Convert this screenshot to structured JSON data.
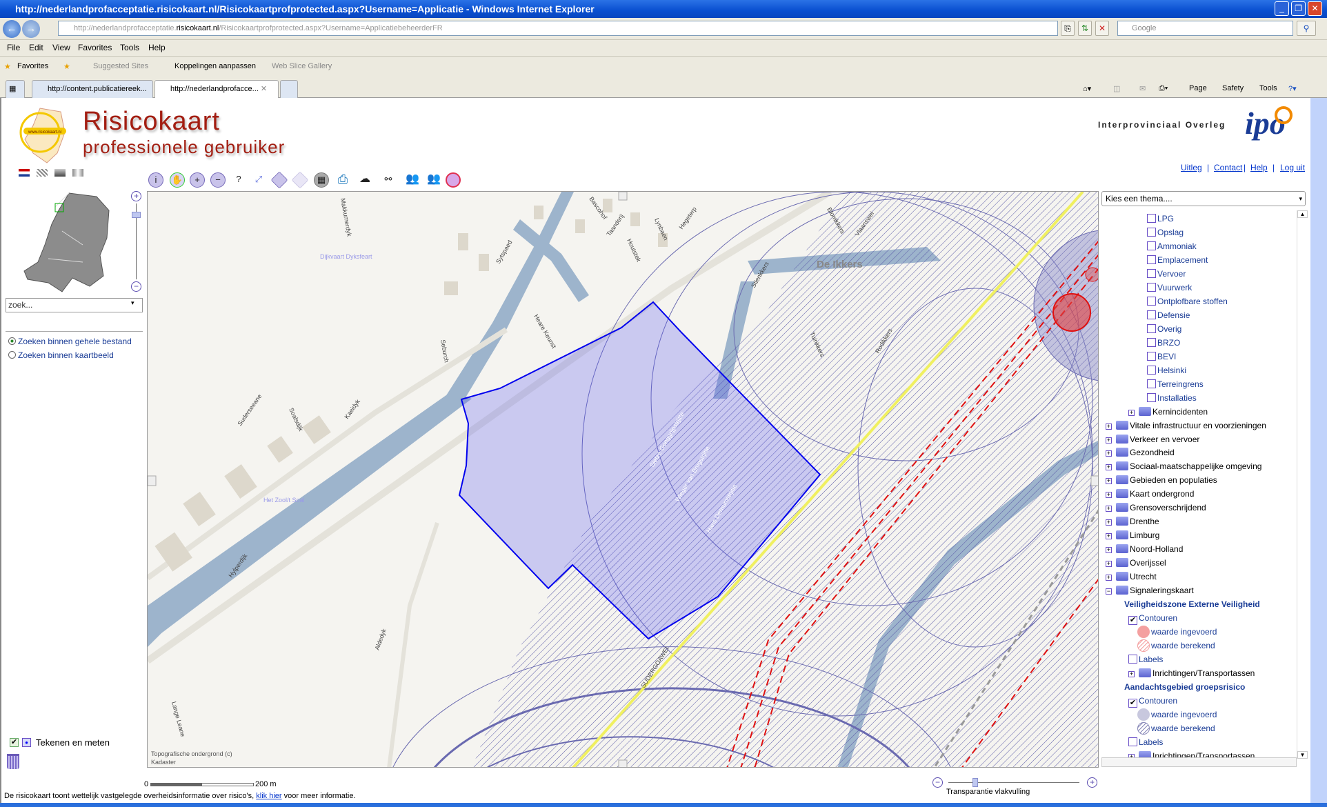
{
  "browser": {
    "title": "http://nederlandprofacceptatie.risicokaart.nl/Risicokaartprofprotected.aspx?Username=Applicatie - Windows Internet Explorer",
    "address_pre": "http://nederlandprofacceptatie.",
    "address_domain": "risicokaart.nl",
    "address_post": "/Risicokaartprofprotected.aspx?Username=ApplicatiebeheerderFR",
    "search_placeholder": "Google",
    "menu": [
      "File",
      "Edit",
      "View",
      "Favorites",
      "Tools",
      "Help"
    ],
    "favorites": {
      "label": "Favorites",
      "items": [
        "Suggested Sites",
        "Koppelingen aanpassen",
        "Web Slice Gallery"
      ]
    },
    "tabs": [
      {
        "label": "http://content.publicatiereek..."
      },
      {
        "label": "http://nederlandprofacce...",
        "active": true
      }
    ],
    "commands": [
      "Page",
      "Safety",
      "Tools"
    ]
  },
  "header": {
    "title": "Risicokaart",
    "subtitle": "professionele gebruiker",
    "logo_text": "www.risicokaart.nl",
    "partner": "Interprovinciaal Overleg",
    "partner_logo": "ipo",
    "links": [
      "Uitleg",
      "Contact",
      "Help",
      "Log uit"
    ]
  },
  "toolbar": {
    "icons": [
      "info-icon",
      "pan-hand-icon",
      "zoom-in-icon",
      "zoom-out-icon",
      "query-icon",
      "full-extent-icon",
      "back-icon",
      "forward-icon",
      "select-icon",
      "print-icon",
      "draw-shape-icon",
      "link-icon",
      "users-icon",
      "users-document-icon",
      "overlap-icon"
    ]
  },
  "left": {
    "search_placeholder": "zoek...",
    "radios": [
      {
        "label": "Zoeken binnen gehele bestand",
        "checked": true
      },
      {
        "label": "Zoeken binnen kaartbeeld",
        "checked": false
      }
    ],
    "draw_label": "Tekenen en meten",
    "scale": {
      "start": "0",
      "end": "200 m"
    },
    "footer_pre": "De risicokaart toont wettelijk vastgelegde overheidsinformatie over risico's, ",
    "footer_link": "klik hier",
    "footer_post": " voor meer informatie."
  },
  "map": {
    "labels": [
      "De Ikkers",
      "Dijkvaart Dyksfeart",
      "Het Zool/t Soal",
      "Makkumerdyk",
      "Sytspaed",
      "Bascohof",
      "Taanderij",
      "Houtstek",
      "Lynbaen",
      "Hegeterp",
      "Heare Keunst",
      "Seburch",
      "Suderseeane",
      "Soalsdijk",
      "Kaeidyk",
      "Hylperdijk",
      "Aldedyk",
      "Lange Leane",
      "Sietze Gonggrijpstrjitte",
      "Wieger van Brugstrjitte",
      "Hans Dernumstrjitte",
      "SUDERGOAWEI",
      "Stienkkers",
      "Blomkkers",
      "Rodikkers",
      "Tuinkkers",
      "Vlaanswei",
      "Topografische ondergrond (c)",
      "Kadaster"
    ],
    "transparency_label": "Transparantie vlakvulling",
    "transparency": 0.2
  },
  "panel": {
    "select": "Kies een thema....",
    "tree": [
      {
        "t": "cb",
        "l": 3,
        "label": "LPG"
      },
      {
        "t": "cb",
        "l": 3,
        "label": "Opslag"
      },
      {
        "t": "cb",
        "l": 3,
        "label": "Ammoniak"
      },
      {
        "t": "cb",
        "l": 3,
        "label": "Emplacement"
      },
      {
        "t": "cb",
        "l": 3,
        "label": "Vervoer"
      },
      {
        "t": "cb",
        "l": 3,
        "label": "Vuurwerk"
      },
      {
        "t": "cb",
        "l": 3,
        "label": "Ontplofbare stoffen"
      },
      {
        "t": "cb",
        "l": 3,
        "label": "Defensie"
      },
      {
        "t": "cb",
        "l": 3,
        "label": "Overig"
      },
      {
        "t": "cb",
        "l": 3,
        "label": "BRZO"
      },
      {
        "t": "cb",
        "l": 3,
        "label": "BEVI"
      },
      {
        "t": "cb",
        "l": 3,
        "label": "Helsinki"
      },
      {
        "t": "cb",
        "l": 3,
        "label": "Terreingrens"
      },
      {
        "t": "cb",
        "l": 3,
        "label": "Installaties"
      },
      {
        "t": "folder",
        "l": 1,
        "label": "Kernincidenten"
      },
      {
        "t": "folder",
        "l": 0,
        "label": "Vitale infrastructuur en voorzieningen"
      },
      {
        "t": "folder",
        "l": 0,
        "label": "Verkeer en vervoer"
      },
      {
        "t": "folder",
        "l": 0,
        "label": "Gezondheid"
      },
      {
        "t": "folder",
        "l": 0,
        "label": "Sociaal-maatschappelijke omgeving"
      },
      {
        "t": "folder",
        "l": 0,
        "label": "Gebieden en populaties"
      },
      {
        "t": "folder",
        "l": 0,
        "label": "Kaart ondergrond"
      },
      {
        "t": "folder",
        "l": 0,
        "label": "Grensoverschrijdend"
      },
      {
        "t": "folder",
        "l": 0,
        "label": "Drenthe"
      },
      {
        "t": "folder",
        "l": 0,
        "label": "Limburg"
      },
      {
        "t": "folder",
        "l": 0,
        "label": "Noord-Holland"
      },
      {
        "t": "folder",
        "l": 0,
        "label": "Overijssel"
      },
      {
        "t": "folder",
        "l": 0,
        "label": "Utrecht"
      },
      {
        "t": "folder",
        "l": 0,
        "label": "Signaleringskaart",
        "open": true
      },
      {
        "t": "hdr",
        "l": 1,
        "label": "Veiligheidszone Externe Veiligheid"
      },
      {
        "t": "cb",
        "l": 1,
        "label": "Contouren",
        "checked": true
      },
      {
        "t": "leg",
        "l": 1,
        "label": "waarde ingevoerd",
        "color": "#f4a0a0",
        "hatch": false
      },
      {
        "t": "leg",
        "l": 1,
        "label": "waarde berekend",
        "color": "#f4a0a0",
        "hatch": true
      },
      {
        "t": "cb",
        "l": 1,
        "label": "Labels"
      },
      {
        "t": "folder",
        "l": 1,
        "label": "Inrichtingen/Transportassen"
      },
      {
        "t": "hdr",
        "l": 1,
        "label": "Aandachtsgebied groepsrisico"
      },
      {
        "t": "cb",
        "l": 1,
        "label": "Contouren",
        "checked": true
      },
      {
        "t": "leg",
        "l": 1,
        "label": "waarde ingevoerd",
        "color": "#c8c8de",
        "hatch": false
      },
      {
        "t": "leg",
        "l": 1,
        "label": "waarde berekend",
        "color": "#8888b8",
        "hatch": true
      },
      {
        "t": "cb",
        "l": 1,
        "label": "Labels"
      },
      {
        "t": "folder",
        "l": 1,
        "label": "Inrichtingen/Transportassen"
      }
    ]
  },
  "colors": {
    "brand": "#a31e12",
    "link": "#0033cc",
    "tree_text": "#1a3c96",
    "polygon": "#0000ee",
    "hatch": "#5a5aa8",
    "risk_red": "#e01010",
    "road_yellow": "#f0f060"
  }
}
